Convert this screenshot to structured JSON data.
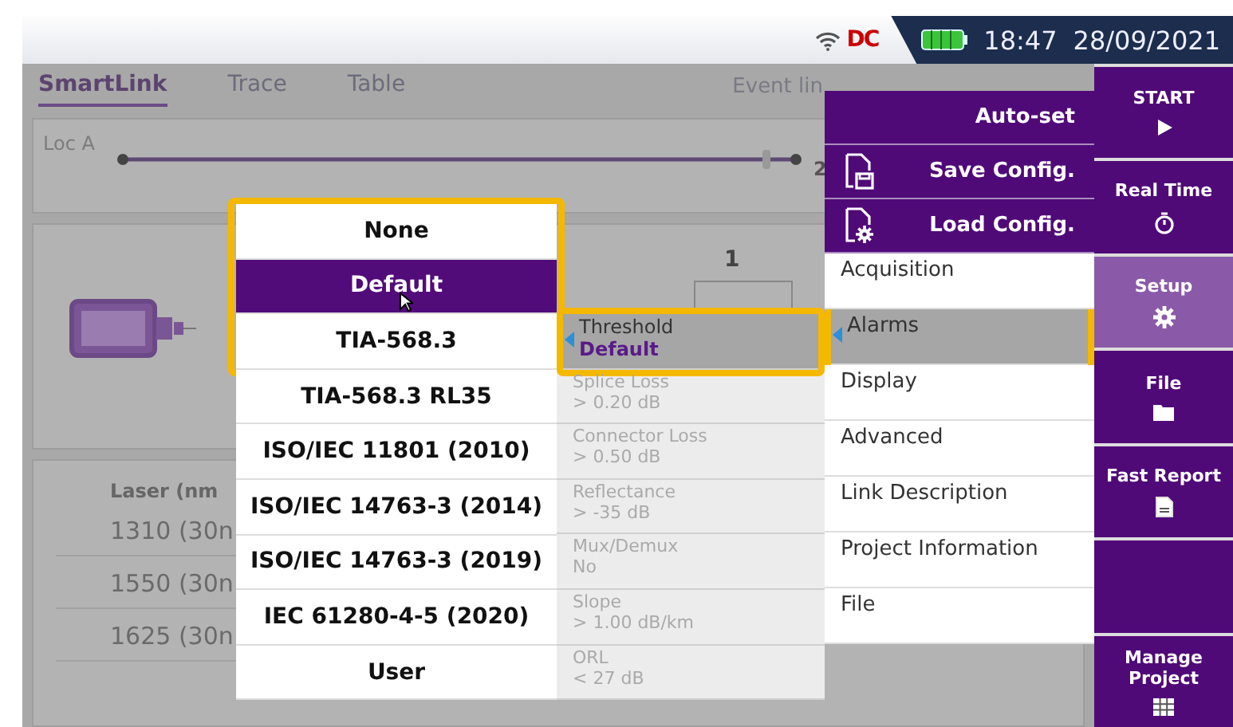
{
  "status_bar": {
    "power": "DC",
    "time": "18:47",
    "date": "28/09/2021"
  },
  "tabs": [
    {
      "label": "SmartLink",
      "selected": true
    },
    {
      "label": "Trace",
      "selected": false
    },
    {
      "label": "Table",
      "selected": false
    }
  ],
  "event_line_label": "Event lin",
  "trace": {
    "start_label": "Loc A",
    "end_label": "2"
  },
  "link": {
    "node_label": "1"
  },
  "laser_table": {
    "header": "Laser (nm",
    "rows": [
      "1310 (30n",
      "1550 (30n",
      "1625 (30n"
    ]
  },
  "preset_menu": [
    {
      "label": "None",
      "selected": false
    },
    {
      "label": "Default",
      "selected": true
    },
    {
      "label": "TIA-568.3",
      "selected": false
    },
    {
      "label": "TIA-568.3 RL35",
      "selected": false
    },
    {
      "label": "ISO/IEC 11801 (2010)",
      "selected": false
    },
    {
      "label": "ISO/IEC 14763-3 (2014)",
      "selected": false
    },
    {
      "label": "ISO/IEC 14763-3 (2019)",
      "selected": false
    },
    {
      "label": "IEC 61280-4-5 (2020)",
      "selected": false
    },
    {
      "label": "User",
      "selected": false
    }
  ],
  "alarm_settings": [
    {
      "label": "Threshold",
      "value": "Default",
      "selected": true
    },
    {
      "label": "Splice Loss",
      "value": "> 0.20 dB",
      "selected": false
    },
    {
      "label": "Connector Loss",
      "value": "> 0.50 dB",
      "selected": false
    },
    {
      "label": "Reflectance",
      "value": "> -35 dB",
      "selected": false
    },
    {
      "label": "Mux/Demux",
      "value": "No",
      "selected": false
    },
    {
      "label": "Slope",
      "value": "> 1.00 dB/km",
      "selected": false
    },
    {
      "label": "ORL",
      "value": "< 27 dB",
      "selected": false
    }
  ],
  "setup_actions": [
    {
      "label": "Auto-set",
      "kind": "plain"
    },
    {
      "label": "Save Config.",
      "kind": "save"
    },
    {
      "label": "Load Config.",
      "kind": "load"
    }
  ],
  "setup_menu": [
    {
      "label": "Acquisition",
      "selected": false
    },
    {
      "label": "Alarms",
      "selected": true
    },
    {
      "label": "Display",
      "selected": false
    },
    {
      "label": "Advanced",
      "selected": false
    },
    {
      "label": "Link Description",
      "selected": false
    },
    {
      "label": "Project Information",
      "selected": false
    },
    {
      "label": "File",
      "selected": false
    }
  ],
  "sidebar": [
    {
      "label": "START",
      "kind": "play",
      "selected": false
    },
    {
      "label": "Real Time",
      "kind": "stopwatch",
      "selected": false
    },
    {
      "label": "Setup",
      "kind": "gear",
      "selected": true
    },
    {
      "label": "File",
      "kind": "folder",
      "selected": false
    },
    {
      "label": "Fast Report",
      "kind": "report",
      "selected": false
    },
    {
      "kind": "blank",
      "selected": false
    },
    {
      "label": "Manage Project",
      "kind": "grid",
      "selected": false
    }
  ]
}
